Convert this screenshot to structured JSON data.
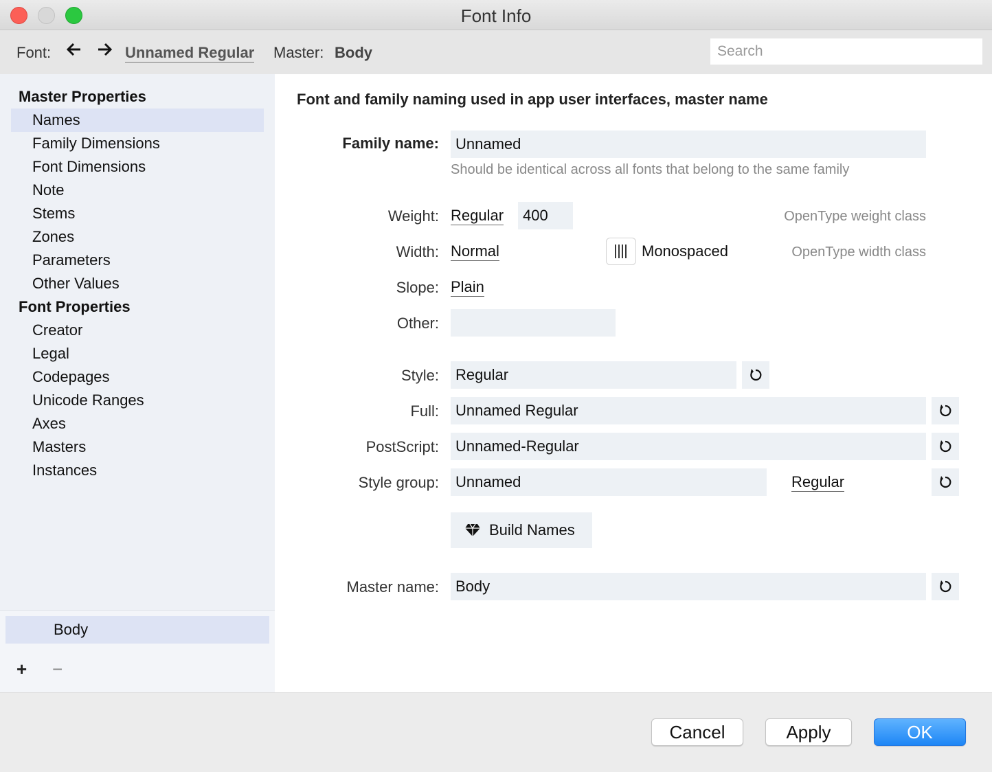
{
  "window": {
    "title": "Font Info"
  },
  "toolbar": {
    "font_label": "Font:",
    "font_name": "Unnamed Regular",
    "master_label": "Master:",
    "master_name": "Body",
    "search_placeholder": "Search"
  },
  "sidebar": {
    "master_properties_heading": "Master Properties",
    "master_items": [
      "Names",
      "Family Dimensions",
      "Font Dimensions",
      "Note",
      "Stems",
      "Zones",
      "Parameters",
      "Other Values"
    ],
    "font_properties_heading": "Font Properties",
    "font_items": [
      "Creator",
      "Legal",
      "Codepages",
      "Unicode Ranges",
      "Axes",
      "Masters",
      "Instances"
    ],
    "selected_item": "Names",
    "masters_list": [
      "Body"
    ],
    "add_label": "+",
    "remove_label": "−"
  },
  "main": {
    "heading": "Font and family naming used in app user interfaces, master name",
    "family_name_label": "Family name:",
    "family_name_value": "Unnamed",
    "family_hint": "Should be identical across all fonts that belong to the same family",
    "weight_label": "Weight:",
    "weight_value": "Regular",
    "weight_class": "400",
    "weight_note": "OpenType weight class",
    "width_label": "Width:",
    "width_value": "Normal",
    "monospaced_label": "Monospaced",
    "width_note": "OpenType width class",
    "slope_label": "Slope:",
    "slope_value": "Plain",
    "other_label": "Other:",
    "other_value": "",
    "style_label": "Style:",
    "style_value": "Regular",
    "full_label": "Full:",
    "full_value": "Unnamed Regular",
    "postscript_label": "PostScript:",
    "postscript_value": "Unnamed-Regular",
    "style_group_label": "Style group:",
    "style_group_value": "Unnamed",
    "style_group_link": "Regular",
    "build_names_label": "Build Names",
    "master_name_label": "Master name:",
    "master_name_value": "Body"
  },
  "footer": {
    "cancel_label": "Cancel",
    "apply_label": "Apply",
    "ok_label": "OK"
  },
  "colors": {
    "accent": "#1e86f5",
    "selection": "#dde3f4",
    "field_bg": "#edf1f5"
  },
  "icons": [
    "arrow-left-icon",
    "arrow-right-icon",
    "reset-icon",
    "monospace-icon",
    "diamond-icon"
  ]
}
